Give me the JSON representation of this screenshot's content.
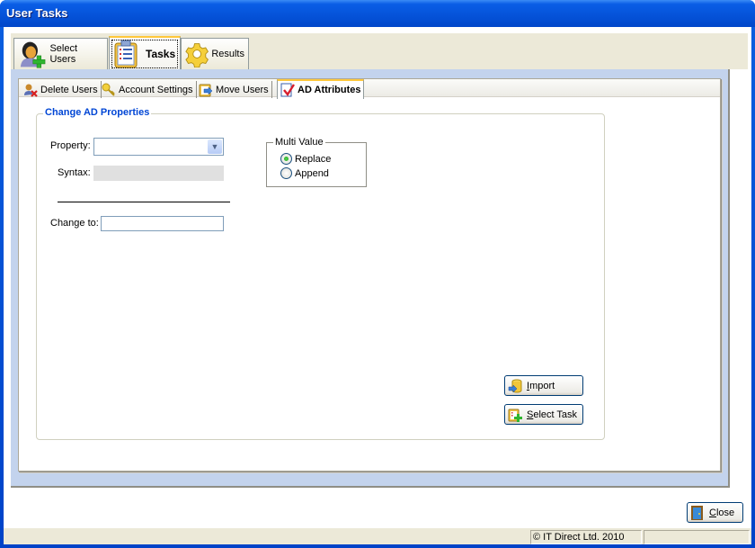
{
  "window": {
    "title": "User Tasks"
  },
  "main_tabs": [
    {
      "label": "Select Users",
      "icon": "user-add-icon",
      "active": false
    },
    {
      "label": "Tasks",
      "icon": "clipboard-list-icon",
      "active": true
    },
    {
      "label": "Results",
      "icon": "gear-icon",
      "active": false
    }
  ],
  "sub_tabs": [
    {
      "label": "Delete Users",
      "icon": "user-delete-icon",
      "active": false
    },
    {
      "label": "Account Settings",
      "icon": "key-icon",
      "active": false
    },
    {
      "label": "Move Users",
      "icon": "move-icon",
      "active": false
    },
    {
      "label": "AD Attributes",
      "icon": "checklist-icon",
      "active": true
    }
  ],
  "group": {
    "title": "Change AD Properties",
    "property_label": "Property:",
    "property_value": "",
    "syntax_label": "Syntax:",
    "syntax_value": "",
    "change_to_label": "Change to:",
    "change_to_value": ""
  },
  "multi_value": {
    "title": "Multi Value",
    "options": [
      {
        "label": "Replace",
        "checked": true
      },
      {
        "label": "Append",
        "checked": false
      }
    ]
  },
  "buttons": {
    "import": {
      "mnemonic": "I",
      "rest": "mport"
    },
    "select_task": {
      "mnemonic": "S",
      "rest": "elect Task"
    },
    "close": {
      "mnemonic": "C",
      "rest": "lose"
    }
  },
  "status": {
    "copyright": "© IT Direct Ltd. 2010",
    "pane2": ""
  },
  "colors": {
    "accent": "#0046d5",
    "panel_bg": "#c3d3ed",
    "tab_highlight": "#ffc83c"
  }
}
